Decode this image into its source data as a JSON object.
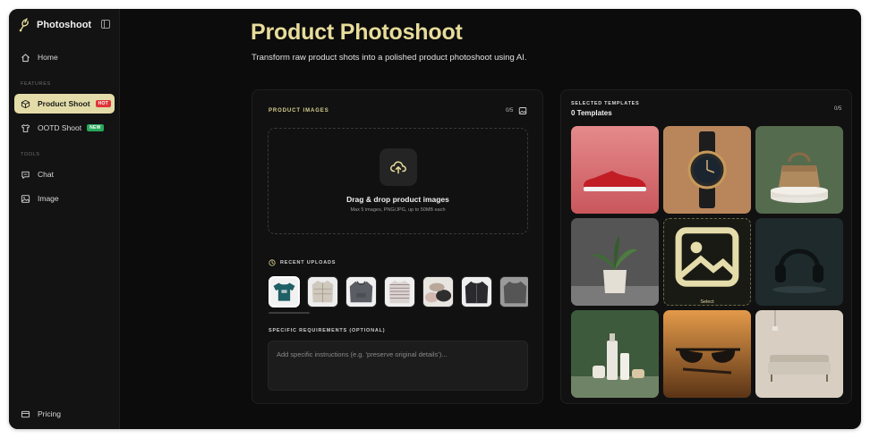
{
  "app": {
    "name": "Photoshoot"
  },
  "sidebar": {
    "home": "Home",
    "features_label": "FEATURES",
    "product_shoot": "Product Shoot",
    "product_shoot_badge": "HOT",
    "ootd_shoot": "OOTD Shoot",
    "ootd_shoot_badge": "NEW",
    "tools_label": "TOOLS",
    "chat": "Chat",
    "image": "Image",
    "pricing": "Pricing"
  },
  "header": {
    "title": "Product Photoshoot",
    "subtitle": "Transform raw product shots into a polished product photoshoot using AI."
  },
  "product_images": {
    "label": "PRODUCT IMAGES",
    "count": "0/5",
    "dropzone_title": "Drag & drop product images",
    "dropzone_hint": "Max 5 images, PNG/JPG, up to 50MB each"
  },
  "recent_uploads": {
    "label": "RECENT UPLOADS"
  },
  "requirements": {
    "label": "SPECIFIC REQUIREMENTS (OPTIONAL)",
    "placeholder": "Add specific instructions (e.g. 'preserve original details')..."
  },
  "templates": {
    "label": "SELECTED TEMPLATES",
    "count_label": "0 Templates",
    "count": "0/5",
    "select_label": "Select"
  },
  "colors": {
    "accent": "#e7dc9a",
    "active_nav": "#e3dca8",
    "badge_hot": "#e0353a",
    "badge_new": "#27a85a",
    "background": "#0c0c0c"
  }
}
